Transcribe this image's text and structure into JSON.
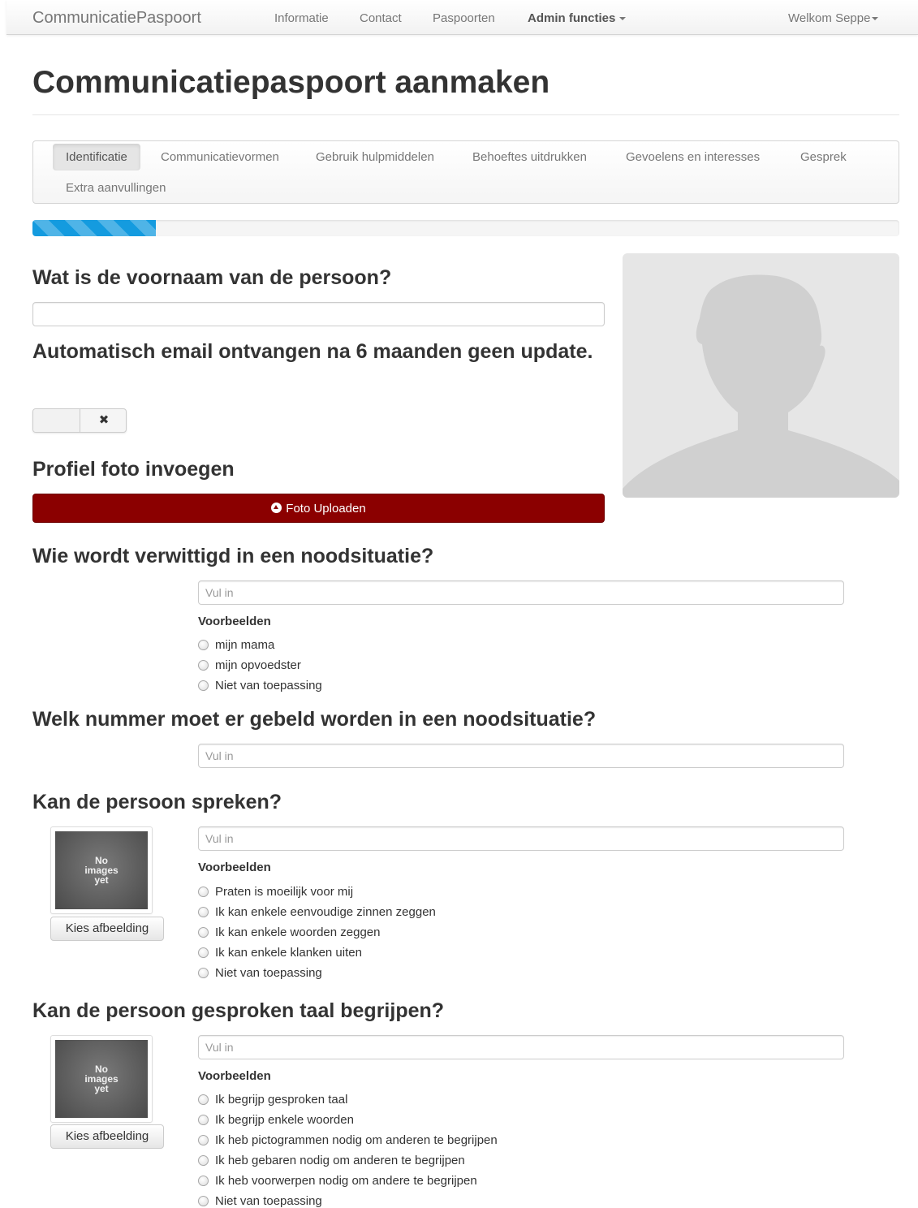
{
  "navbar": {
    "brand": "CommunicatiePaspoort",
    "links": [
      "Informatie",
      "Contact",
      "Paspoorten"
    ],
    "admin": "Admin functies",
    "welcome": "Welkom Seppe"
  },
  "page": {
    "title": "Communicatiepaspoort aanmaken"
  },
  "tabs": [
    "Identificatie",
    "Communicatievormen",
    "Gebruik hulpmiddelen",
    "Behoeftes uitdrukken",
    "Gevoelens en interesses",
    "Gesprek",
    "Extra aanvullingen"
  ],
  "progress": {
    "value": 0.142
  },
  "sections": {
    "first_name": {
      "question": "Wat is de voornaam van de persoon?",
      "value": ""
    },
    "auto_email": {
      "question": "Automatisch email ontvangen na 6 maanden geen update.",
      "toggle_symbol": "✖",
      "state": "off"
    },
    "profile_photo": {
      "question": "Profiel foto invoegen",
      "button": "Foto Uploaden"
    },
    "emergency_contact": {
      "question": "Wie wordt verwittigd in een noodsituatie?",
      "placeholder": "Vul in",
      "examples_label": "Voorbeelden",
      "options": [
        "mijn mama",
        "mijn opvoedster",
        "Niet van toepassing"
      ]
    },
    "emergency_number": {
      "question": "Welk nummer moet er gebeld worden in een noodsituatie?",
      "placeholder": "Vul in"
    },
    "can_speak": {
      "question": "Kan de persoon spreken?",
      "placeholder": "Vul in",
      "examples_label": "Voorbeelden",
      "no_image": [
        "No",
        "images",
        "yet"
      ],
      "choose_button": "Kies afbeelding",
      "options": [
        "Praten is moeilijk voor mij",
        "Ik kan enkele eenvoudige zinnen zeggen",
        "Ik kan enkele woorden zeggen",
        "Ik kan enkele klanken uiten",
        "Niet van toepassing"
      ]
    },
    "understand_language": {
      "question": "Kan de persoon gesproken taal begrijpen?",
      "placeholder": "Vul in",
      "examples_label": "Voorbeelden",
      "no_image": [
        "No",
        "images",
        "yet"
      ],
      "choose_button": "Kies afbeelding",
      "options": [
        "Ik begrijp gesproken taal",
        "Ik begrijp enkele woorden",
        "Ik heb pictogrammen nodig om anderen te begrijpen",
        "Ik heb gebaren nodig om anderen te begrijpen",
        "Ik heb voorwerpen nodig om andere te begrijpen",
        "Niet van toepassing"
      ]
    }
  },
  "colors": {
    "upload_button": "#8b0000",
    "progress": "#149bdf"
  },
  "icons": {
    "upload": "upload-circle-icon",
    "toggle": "close-icon",
    "avatar": "person-silhouette-icon",
    "dropdown": "caret-down-icon"
  }
}
